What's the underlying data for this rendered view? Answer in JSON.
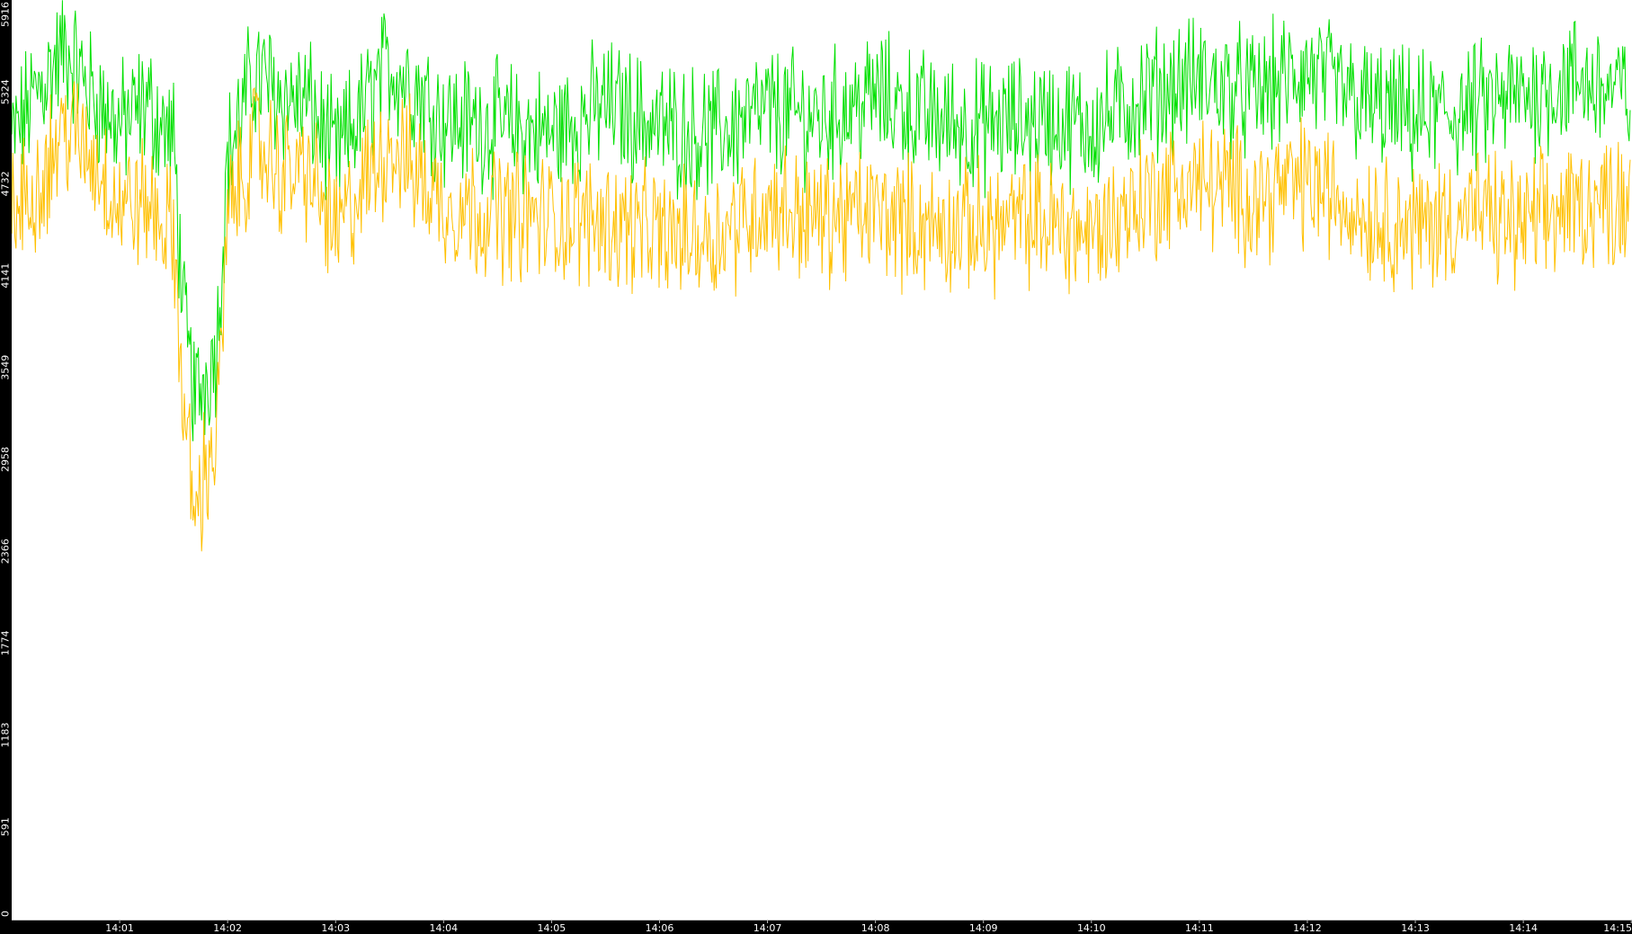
{
  "chart_data": {
    "type": "line",
    "title": "",
    "xlabel": "",
    "ylabel": "",
    "ylim": [
      0,
      5916
    ],
    "y_ticks": [
      "0",
      "591",
      "1183",
      "1774",
      "2366",
      "2958",
      "3549",
      "4141",
      "4732",
      "5324",
      "5916"
    ],
    "x_range_minutes": [
      0,
      14.99
    ],
    "x_ticks": [
      {
        "label": "14:01",
        "minute": 1
      },
      {
        "label": "14:02",
        "minute": 2
      },
      {
        "label": "14:03",
        "minute": 3
      },
      {
        "label": "14:04",
        "minute": 4
      },
      {
        "label": "14:05",
        "minute": 5
      },
      {
        "label": "14:06",
        "minute": 6
      },
      {
        "label": "14:07",
        "minute": 7
      },
      {
        "label": "14:08",
        "minute": 8
      },
      {
        "label": "14:09",
        "minute": 9
      },
      {
        "label": "14:10",
        "minute": 10
      },
      {
        "label": "14:11",
        "minute": 11
      },
      {
        "label": "14:12",
        "minute": 12
      },
      {
        "label": "14:13",
        "minute": 13
      },
      {
        "label": "14:14",
        "minute": 14
      },
      {
        "label": "14:15",
        "minute": 15
      }
    ],
    "grid": false,
    "legend": "none",
    "background": "#ffffff",
    "axis_color": "#000000",
    "tick_text_color": "#ffffff",
    "series": [
      {
        "color": "#00e000",
        "x": [
          0,
          0.25,
          0.5,
          0.75,
          1,
          1.25,
          1.5,
          1.6,
          1.7,
          1.8,
          1.9,
          2,
          2.25,
          2.5,
          2.75,
          3,
          3.25,
          3.5,
          3.75,
          4,
          4.5,
          5,
          5.5,
          6,
          6.5,
          7,
          7.5,
          8,
          8.5,
          9,
          9.5,
          10,
          10.5,
          11,
          11.5,
          12,
          12.5,
          13,
          13.5,
          14,
          14.5,
          14.99
        ],
        "y": [
          5000,
          5350,
          5600,
          5300,
          5100,
          5250,
          5000,
          3800,
          3350,
          3500,
          3700,
          4900,
          5450,
          5300,
          5250,
          4900,
          5200,
          5500,
          5350,
          5150,
          5100,
          5050,
          5250,
          5100,
          5050,
          5200,
          5150,
          5300,
          5150,
          5100,
          5150,
          5100,
          5300,
          5400,
          5300,
          5450,
          5250,
          5150,
          5200,
          5300,
          5400,
          5300
        ]
      },
      {
        "color": "#ffc000",
        "x": [
          0,
          0.25,
          0.5,
          0.75,
          1,
          1.25,
          1.5,
          1.6,
          1.7,
          1.8,
          1.9,
          2,
          2.25,
          2.5,
          2.75,
          3,
          3.25,
          3.5,
          3.75,
          4,
          4.5,
          5,
          5.5,
          6,
          6.5,
          7,
          7.5,
          8,
          8.5,
          9,
          9.5,
          10,
          10.5,
          11,
          11.5,
          12,
          12.5,
          13,
          13.5,
          14,
          14.5,
          14.99
        ],
        "y": [
          4500,
          4750,
          5100,
          4900,
          4600,
          4600,
          4400,
          3200,
          2600,
          2900,
          3100,
          4500,
          5000,
          4800,
          4800,
          4400,
          4700,
          5000,
          4800,
          4600,
          4550,
          4500,
          4500,
          4400,
          4400,
          4600,
          4500,
          4550,
          4450,
          4450,
          4500,
          4400,
          4650,
          4750,
          4650,
          4750,
          4550,
          4450,
          4550,
          4450,
          4600,
          4650
        ]
      }
    ]
  }
}
